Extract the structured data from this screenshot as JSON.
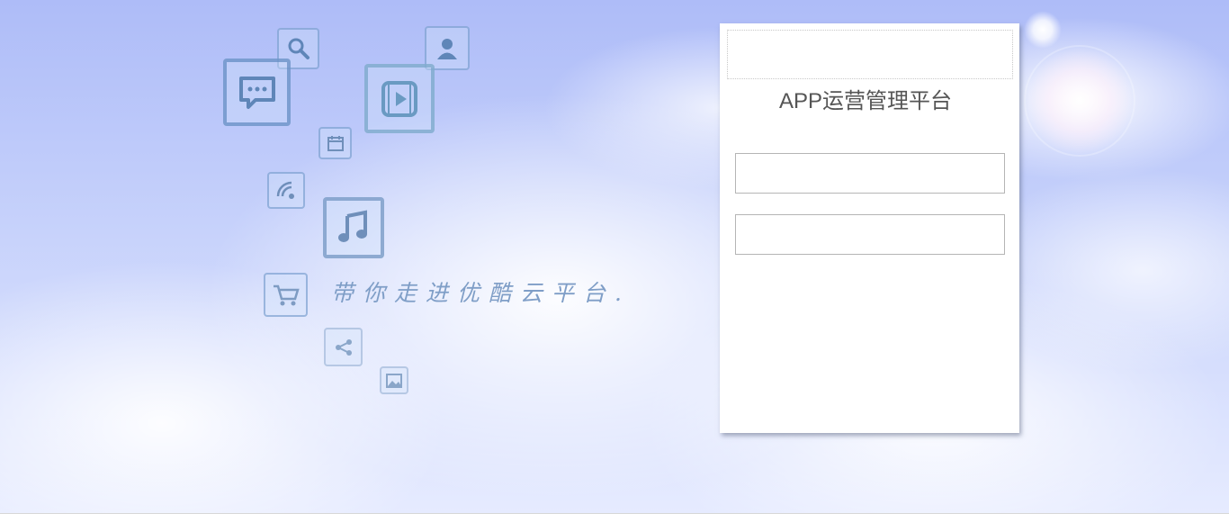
{
  "background": {
    "sky_color": "#b5c3f9",
    "slogan": "带你走进优酷云平台."
  },
  "decor_icons": [
    {
      "name": "search-icon"
    },
    {
      "name": "user-icon"
    },
    {
      "name": "chat-icon"
    },
    {
      "name": "video-icon"
    },
    {
      "name": "calendar-icon"
    },
    {
      "name": "wifi-icon"
    },
    {
      "name": "music-icon"
    },
    {
      "name": "cart-icon"
    },
    {
      "name": "share-icon"
    },
    {
      "name": "image-icon"
    }
  ],
  "login": {
    "title": "APP运营管理平台",
    "username": {
      "value": "",
      "placeholder": ""
    },
    "password": {
      "value": "",
      "placeholder": ""
    }
  },
  "colors": {
    "icon_stroke": "#6e96c8",
    "title_text": "#555555",
    "slogan_text": "#7f9ec7"
  }
}
